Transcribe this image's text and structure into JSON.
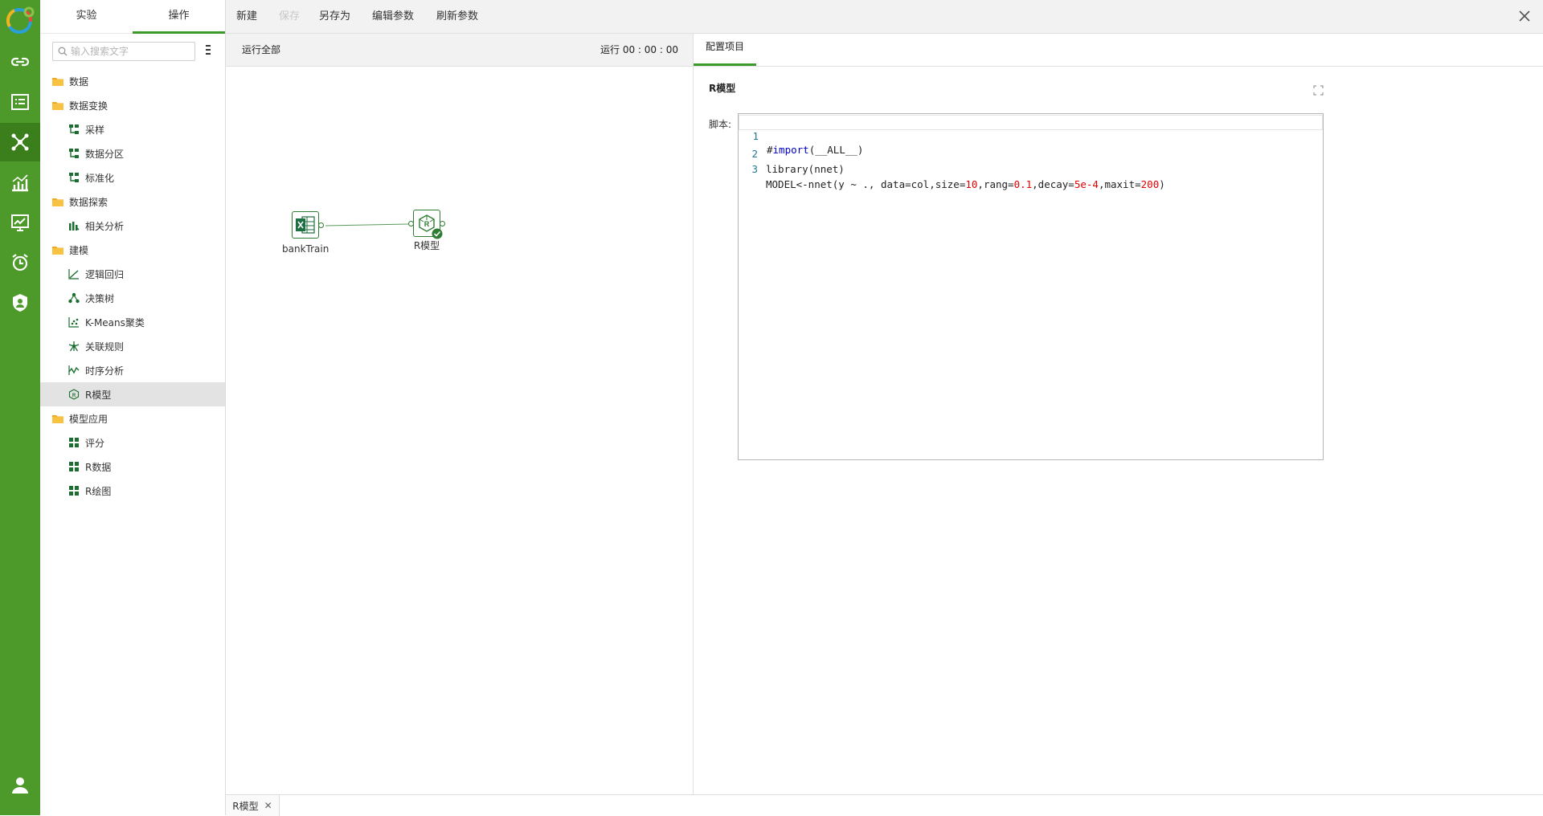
{
  "rail": {
    "items": [
      {
        "name": "link-icon"
      },
      {
        "name": "list-icon"
      },
      {
        "name": "network-icon",
        "active": true
      },
      {
        "name": "bar-chart-icon"
      },
      {
        "name": "line-chart-icon"
      },
      {
        "name": "alarm-icon"
      },
      {
        "name": "shield-icon"
      }
    ],
    "bottom": {
      "name": "user-icon"
    }
  },
  "left_panel": {
    "tabs": [
      {
        "label": "实验",
        "active": false
      },
      {
        "label": "操作",
        "active": true
      }
    ],
    "search": {
      "placeholder": "输入搜索文字"
    },
    "tree": [
      {
        "type": "folder",
        "label": "数据"
      },
      {
        "type": "folder",
        "label": "数据变换"
      },
      {
        "type": "leaf",
        "label": "采样",
        "icon": "transform-icon"
      },
      {
        "type": "leaf",
        "label": "数据分区",
        "icon": "transform-icon"
      },
      {
        "type": "leaf",
        "label": "标准化",
        "icon": "transform-icon"
      },
      {
        "type": "folder",
        "label": "数据探索"
      },
      {
        "type": "leaf",
        "label": "相关分析",
        "icon": "correlation-icon"
      },
      {
        "type": "folder",
        "label": "建模"
      },
      {
        "type": "leaf",
        "label": "逻辑回归",
        "icon": "regression-icon"
      },
      {
        "type": "leaf",
        "label": "决策树",
        "icon": "tree-icon"
      },
      {
        "type": "leaf",
        "label": "K-Means聚类",
        "icon": "cluster-icon"
      },
      {
        "type": "leaf",
        "label": "关联规则",
        "icon": "association-icon"
      },
      {
        "type": "leaf",
        "label": "时序分析",
        "icon": "timeseries-icon"
      },
      {
        "type": "leaf",
        "label": "R模型",
        "icon": "r-model-icon",
        "selected": true
      },
      {
        "type": "folder",
        "label": "模型应用"
      },
      {
        "type": "leaf",
        "label": "评分",
        "icon": "grid-icon"
      },
      {
        "type": "leaf",
        "label": "R数据",
        "icon": "grid-icon"
      },
      {
        "type": "leaf",
        "label": "R绘图",
        "icon": "grid-icon"
      }
    ]
  },
  "toolbar": {
    "new_label": "新建",
    "save_label": "保存",
    "save_as_label": "另存为",
    "edit_params_label": "编辑参数",
    "refresh_params_label": "刷新参数"
  },
  "canvas": {
    "run_all_label": "运行全部",
    "run_time_label": "运行 00 : 00 : 00",
    "nodes": {
      "source_label": "bankTrain",
      "model_label": "R模型"
    }
  },
  "config": {
    "tab_label": "配置项目",
    "title": "R模型",
    "script_label": "脚本:",
    "lines": [
      "1",
      "2",
      "3"
    ]
  },
  "bottom_tabs": [
    {
      "label": "R模型"
    }
  ],
  "colors": {
    "rail": "#4d9a2a",
    "accent": "#3c9a2a",
    "node_border": "#2e7d32",
    "code_number": "#e00000",
    "code_keyword": "#0000c8"
  }
}
